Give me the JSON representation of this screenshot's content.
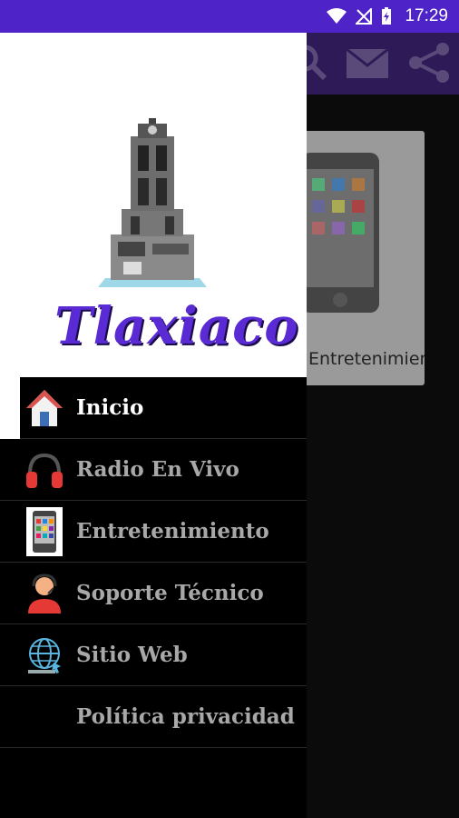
{
  "status_bar": {
    "time": "17:29"
  },
  "background": {
    "card_label": "Entretenimiento"
  },
  "drawer": {
    "logo_text": "Tlaxiaco",
    "menu": [
      {
        "label": "Inicio",
        "icon": "home-icon",
        "active": true
      },
      {
        "label": "Radio En Vivo",
        "icon": "headphones-icon",
        "active": false
      },
      {
        "label": "Entretenimiento",
        "icon": "phone-apps-icon",
        "active": false
      },
      {
        "label": "Soporte Técnico",
        "icon": "support-agent-icon",
        "active": false
      },
      {
        "label": "Sitio Web",
        "icon": "globe-icon",
        "active": false
      },
      {
        "label": "Política privacidad",
        "icon": "",
        "active": false
      }
    ]
  },
  "colors": {
    "status_bar": "#4e24c9",
    "app_bar": "#2d1a57",
    "logo": "#5a2ad4"
  }
}
